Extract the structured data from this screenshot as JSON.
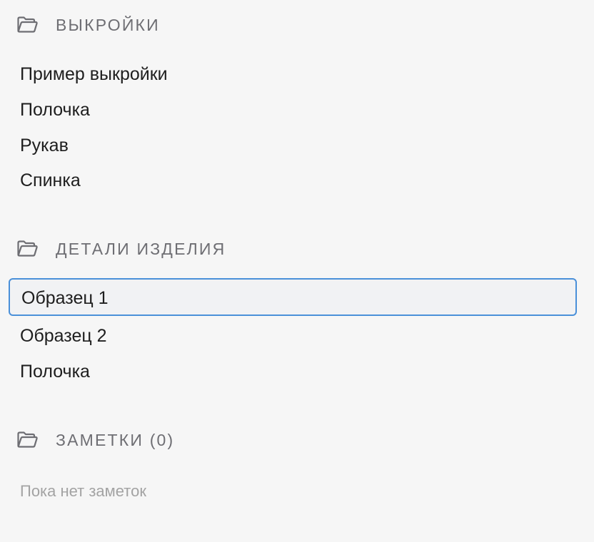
{
  "sections": [
    {
      "title": "ВЫКРОЙКИ",
      "icon": "folder-open-icon",
      "items": [
        {
          "label": "Пример выкройки"
        },
        {
          "label": "Полочка"
        },
        {
          "label": "Рукав"
        },
        {
          "label": "Спинка"
        }
      ]
    },
    {
      "title": "ДЕТАЛИ ИЗДЕЛИЯ",
      "icon": "folder-open-icon",
      "items": [
        {
          "label": "Образец 1",
          "selected": true
        },
        {
          "label": "Образец 2"
        },
        {
          "label": "Полочка"
        }
      ]
    },
    {
      "title": "ЗАМЕТКИ (0)",
      "icon": "folder-open-icon",
      "empty_text": "Пока нет заметок"
    }
  ],
  "colors": {
    "background": "#f6f6f6",
    "section_title": "#6e6e73",
    "selection_border": "#4a90d9",
    "selection_background": "#f1f2f4",
    "empty_text": "#a3a3a3"
  }
}
